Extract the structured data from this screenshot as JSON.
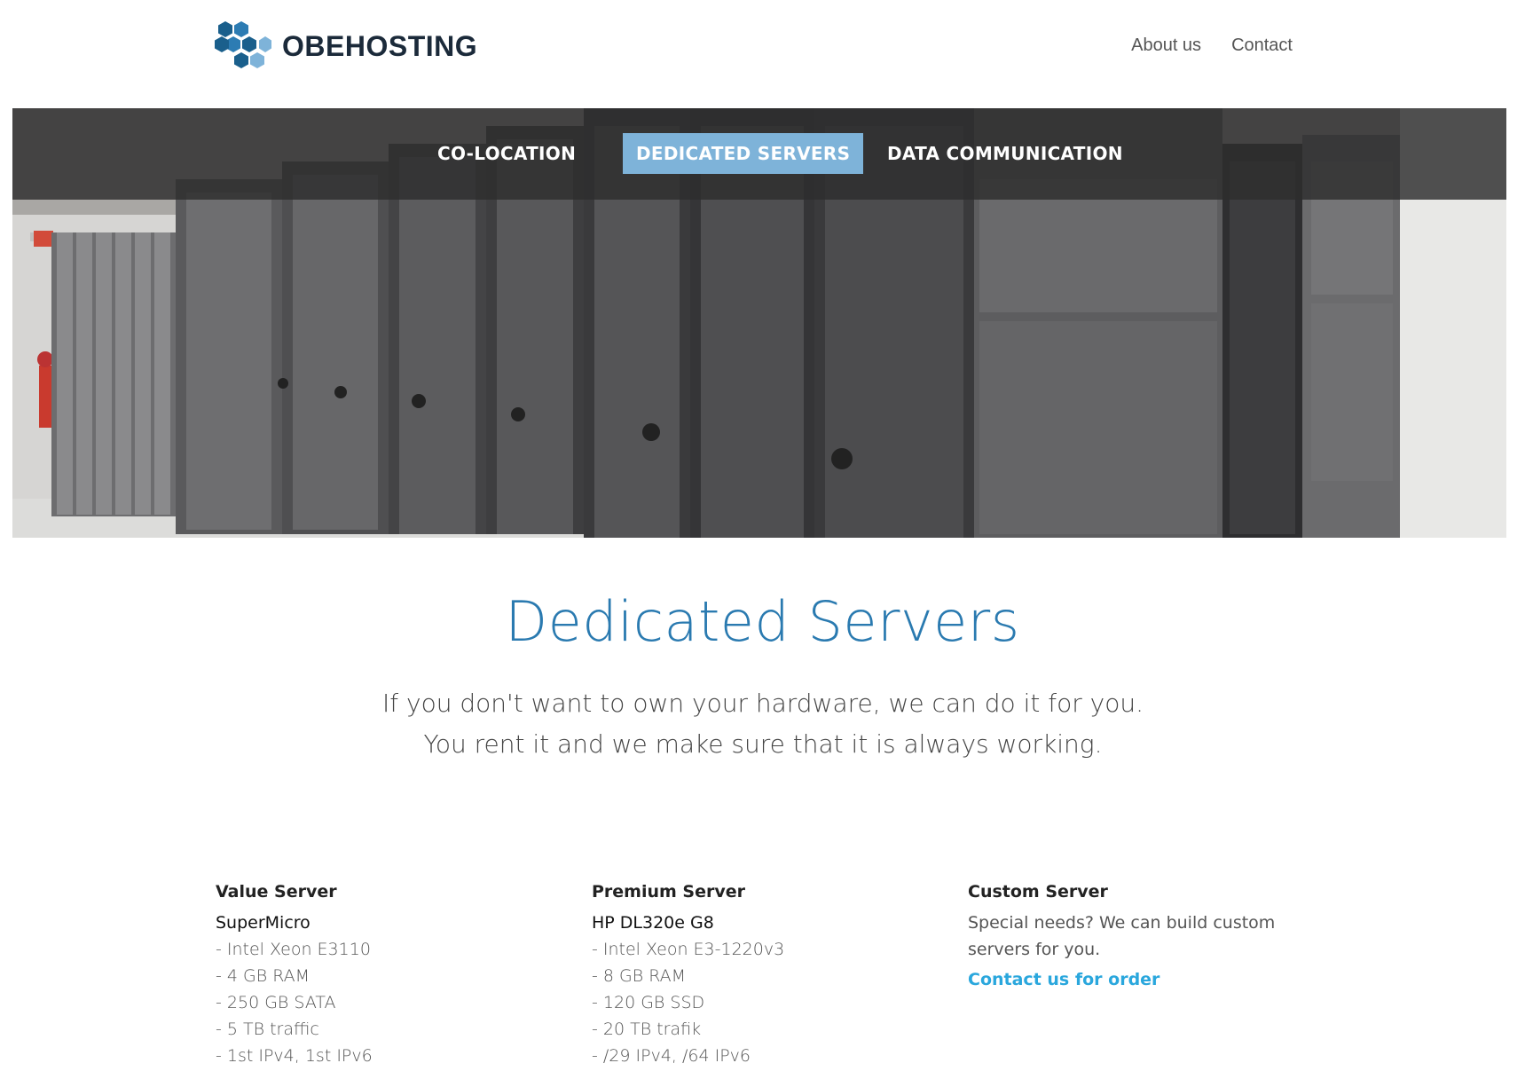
{
  "brand": {
    "name_bold": "OBE",
    "name_rest": "HOSTING",
    "colors": {
      "dark_hex": "#1a5f8c",
      "light_hex": "#7eb3d9",
      "text": "#1b2a3a"
    }
  },
  "top_nav": {
    "items": [
      {
        "label": "About us"
      },
      {
        "label": "Contact"
      }
    ]
  },
  "main_nav": {
    "items": [
      {
        "label": "CO-LOCATION",
        "active": false
      },
      {
        "label": "DEDICATED SERVERS",
        "active": true
      },
      {
        "label": "DATA COMMUNICATION",
        "active": false
      }
    ],
    "active_color": "#7eb3d9"
  },
  "main": {
    "title": "Dedicated Servers",
    "intro": "If you don't want to own your hardware, we can do it for you. You rent it and we make sure that it is always working.",
    "columns": {
      "value": {
        "heading": "Value Server",
        "model": "SuperMicro",
        "specs": [
          "- Intel Xeon E3110",
          "- 4 GB RAM",
          "- 250 GB SATA",
          "- 5 TB traffic",
          "- 1st IPv4, 1st IPv6"
        ]
      },
      "premium": {
        "heading": "Premium Server",
        "model": "HP DL320e G8",
        "specs": [
          "- Intel Xeon E3-1220v3",
          "- 8 GB RAM",
          "- 120 GB SSD",
          "- 20 TB trafik",
          "- /29 IPv4, /64 IPv6"
        ]
      },
      "custom": {
        "heading": "Custom Server",
        "text": "Special needs? We can build custom servers for you.",
        "link": "Contact us for order"
      }
    }
  },
  "colors": {
    "title_blue": "#2a7ab0",
    "link_blue": "#2aa7dd"
  }
}
